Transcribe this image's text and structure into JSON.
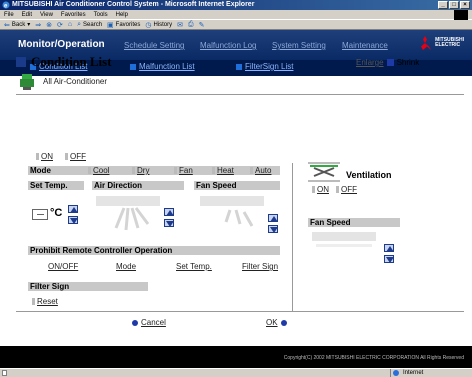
{
  "window": {
    "title": "MITSUBISHI Air Conditioner Control System - Microsoft Internet Explorer"
  },
  "menubar": [
    "File",
    "Edit",
    "View",
    "Favorites",
    "Tools",
    "Help"
  ],
  "toolbar": {
    "back": "Back",
    "search": "Search",
    "favorites": "Favorites",
    "history": "History"
  },
  "header": {
    "brand": "Monitor/Operation",
    "nav": [
      "Schedule Setting",
      "Malfunction Log",
      "System Setting",
      "Maintenance"
    ],
    "logo_text": [
      "MITSUBISHI",
      "ELECTRIC"
    ],
    "subnav": [
      "Condition List",
      "Malfunction List",
      "FilterSign List"
    ]
  },
  "page": {
    "title": "Condition List",
    "enlarge": "Enlarge",
    "shrink": "Shrink",
    "group_name": "All Air-Conditioner"
  },
  "onoff": {
    "on": "ON",
    "off": "OFF"
  },
  "mode": {
    "label": "Mode",
    "options": [
      "Cool",
      "Dry",
      "Fan",
      "Heat",
      "Auto"
    ]
  },
  "settemp": {
    "label": "Set Temp.",
    "unit": "°C"
  },
  "airdirection": {
    "label": "Air Direction"
  },
  "fanspeed": {
    "label": "Fan Speed"
  },
  "prohibit": {
    "label": "Prohibit Remote Controller Operation",
    "links": [
      "ON/OFF",
      "Mode",
      "Set Temp.",
      "Filter Sign"
    ]
  },
  "filtersign": {
    "label": "Filter Sign",
    "reset": "Reset"
  },
  "ventilation": {
    "label": "Ventilation",
    "on": "ON",
    "off": "OFF",
    "fanspeed_label": "Fan Speed"
  },
  "actions": {
    "cancel": "Cancel",
    "ok": "OK"
  },
  "footer": {
    "copyright": "Copyright(C) 2002 MITSUBISHI ELECTRIC CORPORATION All Rights Reserved"
  },
  "statusbar": {
    "zone": "Internet"
  },
  "colors": {
    "nav_bg": "#0a2a66",
    "subnav_bg": "#001a4d",
    "accent": "#1e3aa8",
    "logo_red": "#e60012"
  }
}
